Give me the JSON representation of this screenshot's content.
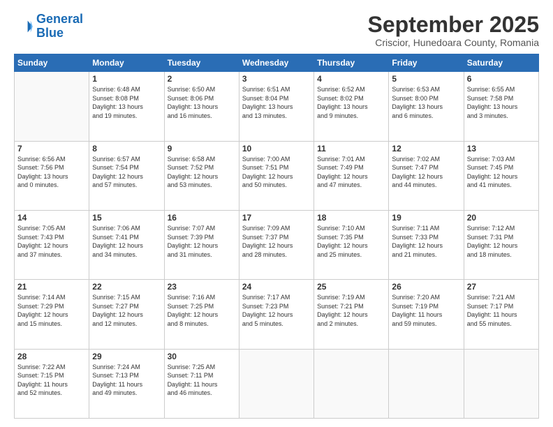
{
  "logo": {
    "line1": "General",
    "line2": "Blue"
  },
  "header": {
    "month": "September 2025",
    "location": "Criscior, Hunedoara County, Romania"
  },
  "weekdays": [
    "Sunday",
    "Monday",
    "Tuesday",
    "Wednesday",
    "Thursday",
    "Friday",
    "Saturday"
  ],
  "weeks": [
    [
      {
        "day": "",
        "info": ""
      },
      {
        "day": "1",
        "info": "Sunrise: 6:48 AM\nSunset: 8:08 PM\nDaylight: 13 hours\nand 19 minutes."
      },
      {
        "day": "2",
        "info": "Sunrise: 6:50 AM\nSunset: 8:06 PM\nDaylight: 13 hours\nand 16 minutes."
      },
      {
        "day": "3",
        "info": "Sunrise: 6:51 AM\nSunset: 8:04 PM\nDaylight: 13 hours\nand 13 minutes."
      },
      {
        "day": "4",
        "info": "Sunrise: 6:52 AM\nSunset: 8:02 PM\nDaylight: 13 hours\nand 9 minutes."
      },
      {
        "day": "5",
        "info": "Sunrise: 6:53 AM\nSunset: 8:00 PM\nDaylight: 13 hours\nand 6 minutes."
      },
      {
        "day": "6",
        "info": "Sunrise: 6:55 AM\nSunset: 7:58 PM\nDaylight: 13 hours\nand 3 minutes."
      }
    ],
    [
      {
        "day": "7",
        "info": "Sunrise: 6:56 AM\nSunset: 7:56 PM\nDaylight: 13 hours\nand 0 minutes."
      },
      {
        "day": "8",
        "info": "Sunrise: 6:57 AM\nSunset: 7:54 PM\nDaylight: 12 hours\nand 57 minutes."
      },
      {
        "day": "9",
        "info": "Sunrise: 6:58 AM\nSunset: 7:52 PM\nDaylight: 12 hours\nand 53 minutes."
      },
      {
        "day": "10",
        "info": "Sunrise: 7:00 AM\nSunset: 7:51 PM\nDaylight: 12 hours\nand 50 minutes."
      },
      {
        "day": "11",
        "info": "Sunrise: 7:01 AM\nSunset: 7:49 PM\nDaylight: 12 hours\nand 47 minutes."
      },
      {
        "day": "12",
        "info": "Sunrise: 7:02 AM\nSunset: 7:47 PM\nDaylight: 12 hours\nand 44 minutes."
      },
      {
        "day": "13",
        "info": "Sunrise: 7:03 AM\nSunset: 7:45 PM\nDaylight: 12 hours\nand 41 minutes."
      }
    ],
    [
      {
        "day": "14",
        "info": "Sunrise: 7:05 AM\nSunset: 7:43 PM\nDaylight: 12 hours\nand 37 minutes."
      },
      {
        "day": "15",
        "info": "Sunrise: 7:06 AM\nSunset: 7:41 PM\nDaylight: 12 hours\nand 34 minutes."
      },
      {
        "day": "16",
        "info": "Sunrise: 7:07 AM\nSunset: 7:39 PM\nDaylight: 12 hours\nand 31 minutes."
      },
      {
        "day": "17",
        "info": "Sunrise: 7:09 AM\nSunset: 7:37 PM\nDaylight: 12 hours\nand 28 minutes."
      },
      {
        "day": "18",
        "info": "Sunrise: 7:10 AM\nSunset: 7:35 PM\nDaylight: 12 hours\nand 25 minutes."
      },
      {
        "day": "19",
        "info": "Sunrise: 7:11 AM\nSunset: 7:33 PM\nDaylight: 12 hours\nand 21 minutes."
      },
      {
        "day": "20",
        "info": "Sunrise: 7:12 AM\nSunset: 7:31 PM\nDaylight: 12 hours\nand 18 minutes."
      }
    ],
    [
      {
        "day": "21",
        "info": "Sunrise: 7:14 AM\nSunset: 7:29 PM\nDaylight: 12 hours\nand 15 minutes."
      },
      {
        "day": "22",
        "info": "Sunrise: 7:15 AM\nSunset: 7:27 PM\nDaylight: 12 hours\nand 12 minutes."
      },
      {
        "day": "23",
        "info": "Sunrise: 7:16 AM\nSunset: 7:25 PM\nDaylight: 12 hours\nand 8 minutes."
      },
      {
        "day": "24",
        "info": "Sunrise: 7:17 AM\nSunset: 7:23 PM\nDaylight: 12 hours\nand 5 minutes."
      },
      {
        "day": "25",
        "info": "Sunrise: 7:19 AM\nSunset: 7:21 PM\nDaylight: 12 hours\nand 2 minutes."
      },
      {
        "day": "26",
        "info": "Sunrise: 7:20 AM\nSunset: 7:19 PM\nDaylight: 11 hours\nand 59 minutes."
      },
      {
        "day": "27",
        "info": "Sunrise: 7:21 AM\nSunset: 7:17 PM\nDaylight: 11 hours\nand 55 minutes."
      }
    ],
    [
      {
        "day": "28",
        "info": "Sunrise: 7:22 AM\nSunset: 7:15 PM\nDaylight: 11 hours\nand 52 minutes."
      },
      {
        "day": "29",
        "info": "Sunrise: 7:24 AM\nSunset: 7:13 PM\nDaylight: 11 hours\nand 49 minutes."
      },
      {
        "day": "30",
        "info": "Sunrise: 7:25 AM\nSunset: 7:11 PM\nDaylight: 11 hours\nand 46 minutes."
      },
      {
        "day": "",
        "info": ""
      },
      {
        "day": "",
        "info": ""
      },
      {
        "day": "",
        "info": ""
      },
      {
        "day": "",
        "info": ""
      }
    ]
  ]
}
